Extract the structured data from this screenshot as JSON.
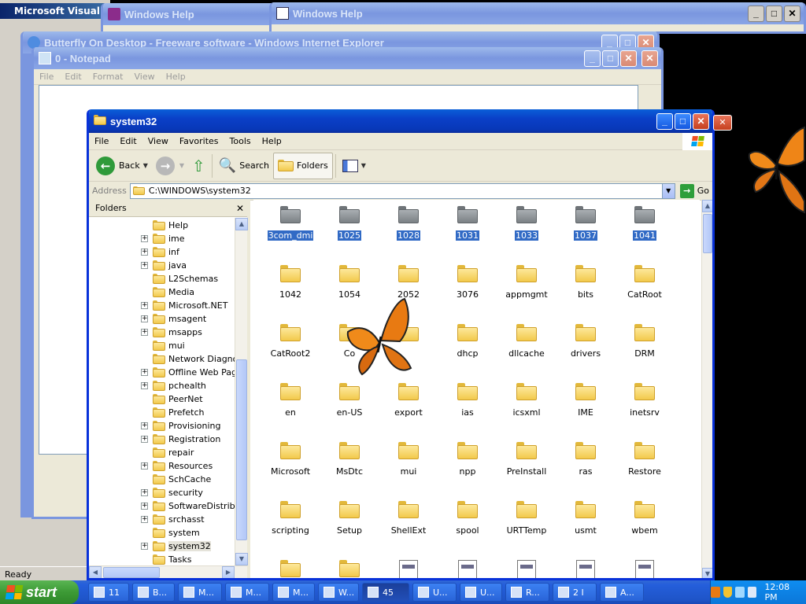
{
  "background_windows": {
    "visual_studio_title": "Microsoft Visual C",
    "help1_title": "Windows Help",
    "help2_title": "Windows Help",
    "ie_title": "Butterfly On Desktop - Freeware software - Windows Internet Explorer",
    "notepad_title": "0 - Notepad",
    "notepad_menu": [
      "File",
      "Edit",
      "Format",
      "View",
      "Help"
    ],
    "status_text": "Ready"
  },
  "explorer": {
    "title": "system32",
    "menu": [
      "File",
      "Edit",
      "View",
      "Favorites",
      "Tools",
      "Help"
    ],
    "toolbar": {
      "back_label": "Back",
      "search_label": "Search",
      "folders_label": "Folders"
    },
    "address": {
      "label": "Address",
      "value": "C:\\WINDOWS\\system32",
      "go_label": "Go"
    },
    "folders_pane": {
      "title": "Folders",
      "items": [
        {
          "label": "Help",
          "expandable": false,
          "selected": false
        },
        {
          "label": "ime",
          "expandable": true,
          "selected": false
        },
        {
          "label": "inf",
          "expandable": true,
          "selected": false
        },
        {
          "label": "java",
          "expandable": true,
          "selected": false
        },
        {
          "label": "L2Schemas",
          "expandable": false,
          "selected": false
        },
        {
          "label": "Media",
          "expandable": false,
          "selected": false
        },
        {
          "label": "Microsoft.NET",
          "expandable": true,
          "selected": false
        },
        {
          "label": "msagent",
          "expandable": true,
          "selected": false
        },
        {
          "label": "msapps",
          "expandable": true,
          "selected": false
        },
        {
          "label": "mui",
          "expandable": false,
          "selected": false
        },
        {
          "label": "Network Diagnost",
          "expandable": false,
          "selected": false
        },
        {
          "label": "Offline Web Page",
          "expandable": true,
          "selected": false
        },
        {
          "label": "pchealth",
          "expandable": true,
          "selected": false
        },
        {
          "label": "PeerNet",
          "expandable": false,
          "selected": false
        },
        {
          "label": "Prefetch",
          "expandable": false,
          "selected": false
        },
        {
          "label": "Provisioning",
          "expandable": true,
          "selected": false
        },
        {
          "label": "Registration",
          "expandable": true,
          "selected": false
        },
        {
          "label": "repair",
          "expandable": false,
          "selected": false
        },
        {
          "label": "Resources",
          "expandable": true,
          "selected": false
        },
        {
          "label": "SchCache",
          "expandable": false,
          "selected": false
        },
        {
          "label": "security",
          "expandable": true,
          "selected": false
        },
        {
          "label": "SoftwareDistribut",
          "expandable": true,
          "selected": false
        },
        {
          "label": "srchasst",
          "expandable": true,
          "selected": false
        },
        {
          "label": "system",
          "expandable": false,
          "selected": false
        },
        {
          "label": "system32",
          "expandable": true,
          "selected": true
        },
        {
          "label": "Tasks",
          "expandable": false,
          "selected": false
        }
      ]
    },
    "files": [
      {
        "label": "3com_dmi",
        "kind": "gray",
        "selected": true
      },
      {
        "label": "1025",
        "kind": "gray",
        "selected": true
      },
      {
        "label": "1028",
        "kind": "gray",
        "selected": true
      },
      {
        "label": "1031",
        "kind": "gray",
        "selected": true
      },
      {
        "label": "1033",
        "kind": "gray",
        "selected": true
      },
      {
        "label": "1037",
        "kind": "gray",
        "selected": true
      },
      {
        "label": "1041",
        "kind": "gray",
        "selected": true
      },
      {
        "label": "1042",
        "kind": "folder",
        "selected": false
      },
      {
        "label": "1054",
        "kind": "folder",
        "selected": false
      },
      {
        "label": "2052",
        "kind": "folder",
        "selected": false
      },
      {
        "label": "3076",
        "kind": "folder",
        "selected": false
      },
      {
        "label": "appmgmt",
        "kind": "folder",
        "selected": false
      },
      {
        "label": "bits",
        "kind": "folder",
        "selected": false
      },
      {
        "label": "CatRoot",
        "kind": "folder",
        "selected": false
      },
      {
        "label": "CatRoot2",
        "kind": "folder",
        "selected": false
      },
      {
        "label": "Co",
        "kind": "folder",
        "selected": false
      },
      {
        "label": "",
        "kind": "folder",
        "selected": false
      },
      {
        "label": "dhcp",
        "kind": "folder",
        "selected": false
      },
      {
        "label": "dllcache",
        "kind": "folder",
        "selected": false
      },
      {
        "label": "drivers",
        "kind": "folder",
        "selected": false
      },
      {
        "label": "DRM",
        "kind": "folder",
        "selected": false
      },
      {
        "label": "en",
        "kind": "folder",
        "selected": false
      },
      {
        "label": "en-US",
        "kind": "folder",
        "selected": false
      },
      {
        "label": "export",
        "kind": "folder",
        "selected": false
      },
      {
        "label": "ias",
        "kind": "folder",
        "selected": false
      },
      {
        "label": "icsxml",
        "kind": "folder",
        "selected": false
      },
      {
        "label": "IME",
        "kind": "folder",
        "selected": false
      },
      {
        "label": "inetsrv",
        "kind": "folder",
        "selected": false
      },
      {
        "label": "Microsoft",
        "kind": "folder",
        "selected": false
      },
      {
        "label": "MsDtc",
        "kind": "folder",
        "selected": false
      },
      {
        "label": "mui",
        "kind": "folder",
        "selected": false
      },
      {
        "label": "npp",
        "kind": "folder",
        "selected": false
      },
      {
        "label": "PreInstall",
        "kind": "folder",
        "selected": false
      },
      {
        "label": "ras",
        "kind": "folder",
        "selected": false
      },
      {
        "label": "Restore",
        "kind": "folder",
        "selected": false
      },
      {
        "label": "scripting",
        "kind": "folder",
        "selected": false
      },
      {
        "label": "Setup",
        "kind": "folder",
        "selected": false
      },
      {
        "label": "ShellExt",
        "kind": "folder",
        "selected": false
      },
      {
        "label": "spool",
        "kind": "folder",
        "selected": false
      },
      {
        "label": "URTTemp",
        "kind": "folder",
        "selected": false
      },
      {
        "label": "usmt",
        "kind": "folder",
        "selected": false
      },
      {
        "label": "wbem",
        "kind": "folder",
        "selected": false
      },
      {
        "label": "",
        "kind": "folder",
        "selected": false
      },
      {
        "label": "",
        "kind": "folder",
        "selected": false
      },
      {
        "label": "",
        "kind": "file",
        "selected": false
      },
      {
        "label": "",
        "kind": "file",
        "selected": false
      },
      {
        "label": "",
        "kind": "file",
        "selected": false
      },
      {
        "label": "",
        "kind": "file",
        "selected": false
      },
      {
        "label": "",
        "kind": "file",
        "selected": false
      }
    ]
  },
  "taskbar": {
    "start_label": "start",
    "tasks": [
      {
        "label": "11",
        "icon": "folder-icon",
        "pressed": false
      },
      {
        "label": "B...",
        "icon": "ie-icon",
        "pressed": false
      },
      {
        "label": "M...",
        "icon": "app-icon",
        "pressed": false
      },
      {
        "label": "M...",
        "icon": "vs-icon",
        "pressed": false
      },
      {
        "label": "M...",
        "icon": "app-icon",
        "pressed": false
      },
      {
        "label": "W...",
        "icon": "help-icon",
        "pressed": false
      },
      {
        "label": "45",
        "icon": "folder-icon",
        "pressed": true
      },
      {
        "label": "U...",
        "icon": "window-icon",
        "pressed": false
      },
      {
        "label": "U...",
        "icon": "window-icon",
        "pressed": false
      },
      {
        "label": "R...",
        "icon": "app-icon",
        "pressed": false
      },
      {
        "label": "2 I",
        "icon": "app-icon",
        "pressed": false
      },
      {
        "label": "A...",
        "icon": "app-icon",
        "pressed": false
      }
    ],
    "clock": "12:08 PM"
  }
}
